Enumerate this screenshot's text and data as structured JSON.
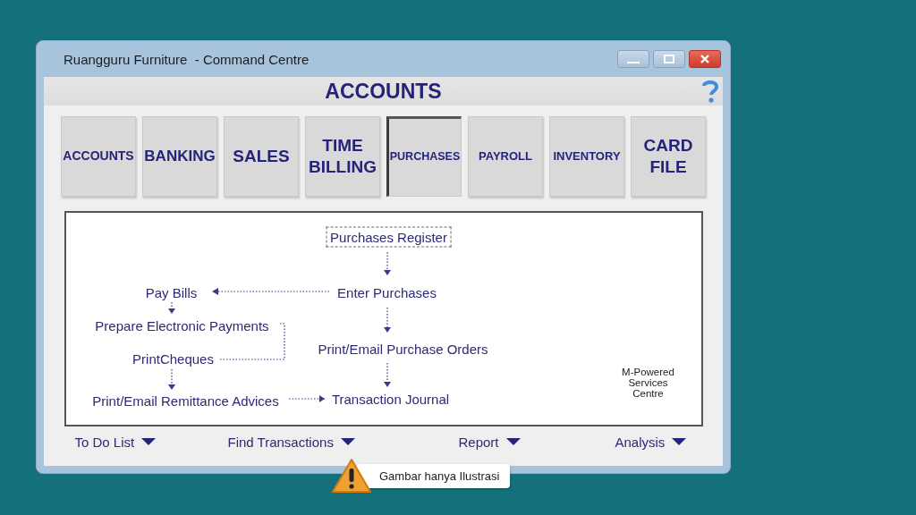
{
  "window": {
    "title": "Ruangguru Furniture  - Command Centre"
  },
  "header": {
    "title": "ACCOUNTS"
  },
  "modules": [
    {
      "label": "ACCOUNTS",
      "selected": false
    },
    {
      "label": "BANKING",
      "selected": false
    },
    {
      "label": "SALES",
      "selected": false
    },
    {
      "label": "TIME BILLING",
      "selected": false
    },
    {
      "label": "PURCHASES",
      "selected": true
    },
    {
      "label": "PAYROLL",
      "selected": false
    },
    {
      "label": "INVENTORY",
      "selected": false
    },
    {
      "label": "CARD FILE",
      "selected": false
    }
  ],
  "flow": {
    "nodes": [
      {
        "label": "Purchases Register",
        "focused": true
      },
      {
        "label": "Enter Purchases",
        "focused": false
      },
      {
        "label": "Pay Bills",
        "focused": false
      },
      {
        "label": "Prepare Electronic Payments",
        "focused": false
      },
      {
        "label": "Print/Email Purchase Orders",
        "focused": false
      },
      {
        "label": "PrintCheques",
        "focused": false
      },
      {
        "label": "Print/Email Remittance Advices",
        "focused": false
      },
      {
        "label": "Transaction Journal",
        "focused": false
      }
    ],
    "note": "M-Powered Services Centre"
  },
  "menus": [
    "To Do List",
    "Find Transactions",
    "Report",
    "Analysis"
  ],
  "disclaimer": "Gambar hanya Ilustrasi"
}
